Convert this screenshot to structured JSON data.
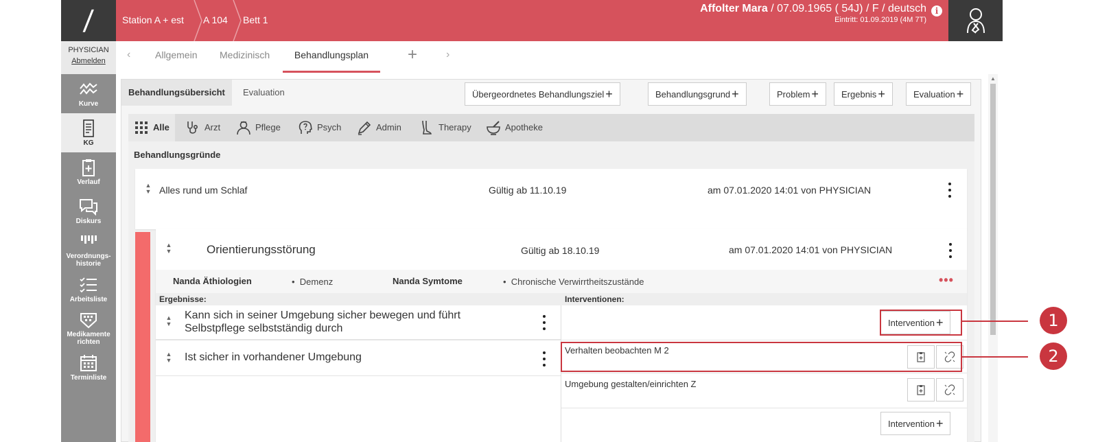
{
  "app": {
    "logo_text": "/"
  },
  "user": {
    "role": "PHYSICIAN",
    "logout_label": "Abmelden"
  },
  "sidenav": [
    {
      "label": "Kurve",
      "icon": "chart-wave-icon",
      "active": false
    },
    {
      "label": "KG",
      "icon": "document-icon",
      "active": true
    },
    {
      "label": "Verlauf",
      "icon": "clipboard-plus-icon",
      "active": false
    },
    {
      "label": "Diskurs",
      "icon": "chat-bubbles-icon",
      "active": false
    },
    {
      "label": "Verordnungs-\nhistorie",
      "icon": "order-history-icon",
      "active": false
    },
    {
      "label": "Arbeitsliste",
      "icon": "checklist-icon",
      "active": false
    },
    {
      "label": "Medikamente\nrichten",
      "icon": "pill-organizer-icon",
      "active": false
    },
    {
      "label": "Terminliste",
      "icon": "calendar-icon",
      "active": false
    }
  ],
  "header": {
    "breadcrumb": [
      "Station A + est",
      "A 104",
      "Bett 1"
    ],
    "patient_name": "Affolter Mara",
    "patient_details": " / 07.09.1965 ( 54J) / F / deutsch",
    "entry": "Eintritt: 01.09.2019 (4M 7T)",
    "accent_color": "#d6525c"
  },
  "tabs": [
    "Allgemein",
    "Medizinisch",
    "Behandlungsplan"
  ],
  "active_tab": "Behandlungsplan",
  "subtabs": [
    "Behandlungsübersicht",
    "Evaluation"
  ],
  "add_buttons": [
    "Übergeordnetes Behandlungsziel",
    "Behandlungsgrund",
    "Problem",
    "Ergebnis",
    "Evaluation"
  ],
  "filters": [
    {
      "label": "Alle",
      "icon": "grid-icon"
    },
    {
      "label": "Arzt",
      "icon": "stethoscope-icon"
    },
    {
      "label": "Pflege",
      "icon": "nurse-icon"
    },
    {
      "label": "Psych",
      "icon": "question-head-icon"
    },
    {
      "label": "Admin",
      "icon": "pen-icon"
    },
    {
      "label": "Therapy",
      "icon": "leg-icon"
    },
    {
      "label": "Apotheke",
      "icon": "mortar-icon"
    }
  ],
  "section_title": "Behandlungsgründe",
  "reason": {
    "title": "Alles rund um Schlaf",
    "valid": "Gültig ab 11.10.19",
    "meta": "am 07.01.2020 14:01 von PHYSICIAN"
  },
  "problem": {
    "title": "Orientierungsstörung",
    "valid": "Gültig ab 18.10.19",
    "meta": "am 07.01.2020 14:01 von PHYSICIAN",
    "nanda_aetiologies_label": "Nanda Äthiologien",
    "nanda_aetiologies": [
      "Demenz"
    ],
    "nanda_symptoms_label": "Nanda Symtome",
    "nanda_symptoms": [
      "Chronische Verwirrtheitszustände"
    ],
    "results_label": "Ergebnisse:",
    "interventions_label": "Interventionen:",
    "results": [
      {
        "line1": "Kann sich in seiner Umgebung sicher bewegen und führt",
        "line2": "Selbstpflege selbstständig durch"
      },
      {
        "line1": "Ist sicher in vorhandener Umgebung"
      }
    ],
    "interventions": [
      "Verhalten beobachten M 2",
      "Umgebung gestalten/einrichten Z"
    ],
    "add_intervention_label": "Intervention"
  },
  "callouts": [
    "1",
    "2"
  ]
}
